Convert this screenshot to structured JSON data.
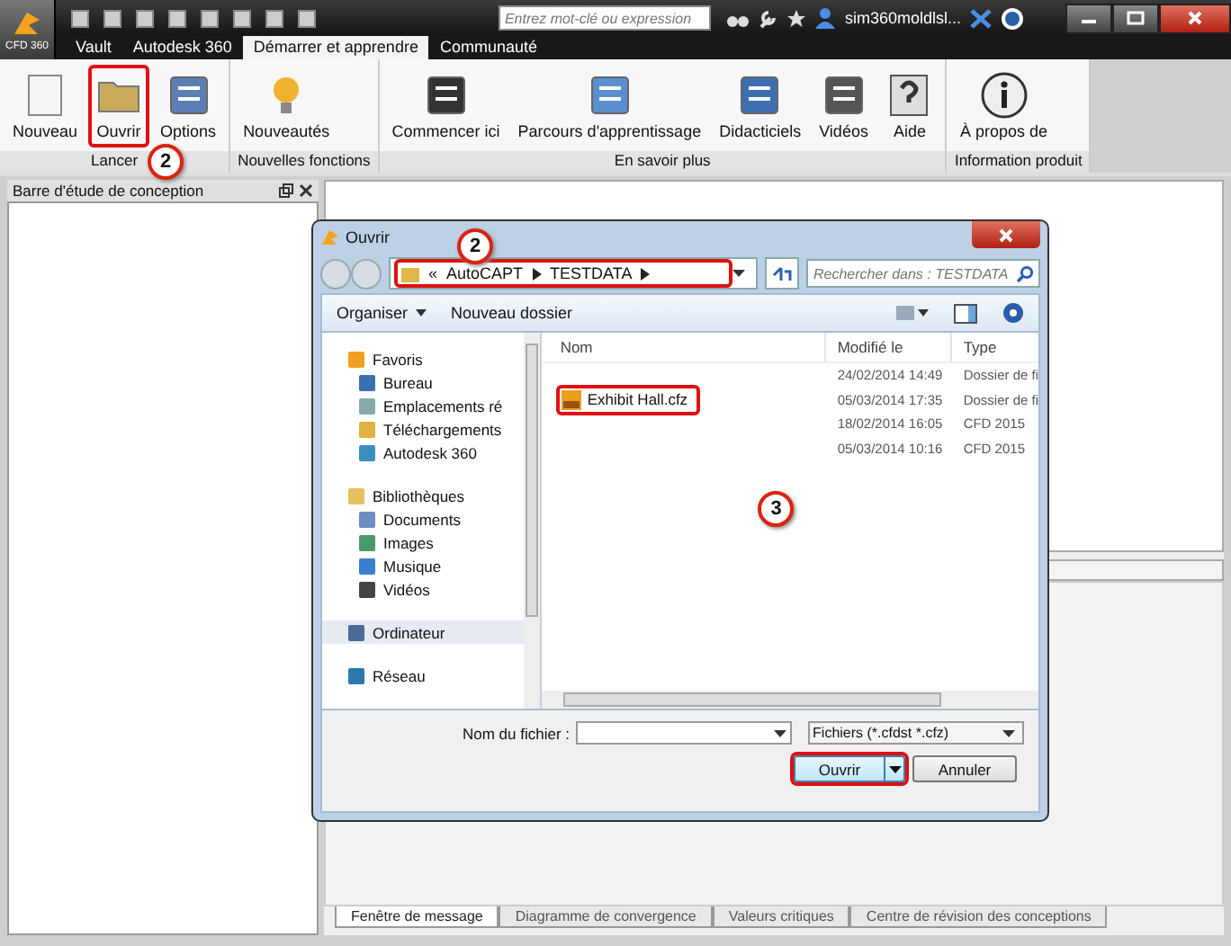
{
  "app": {
    "logo_label": "CFD 360",
    "search": {
      "placeholder": "Entrez mot-clé ou expression"
    },
    "user": "sim360moldlsl..."
  },
  "ribbon_tabs": [
    {
      "label": "Vault",
      "selected": false
    },
    {
      "label": "Autodesk 360",
      "selected": false
    },
    {
      "label": "Démarrer et apprendre",
      "selected": true
    },
    {
      "label": "Communauté",
      "selected": false
    }
  ],
  "ribbon_groups": [
    {
      "label": "Lancer",
      "buttons": [
        {
          "label": "Nouveau",
          "kind": "new",
          "highlighted": false
        },
        {
          "label": "Ouvrir",
          "kind": "open",
          "highlighted": true,
          "callout": "2"
        },
        {
          "label": "Options",
          "kind": "options",
          "highlighted": false
        }
      ]
    },
    {
      "label": "Nouvelles fonctions",
      "buttons": [
        {
          "label": "Nouveautés",
          "kind": "bulb",
          "highlighted": false
        }
      ]
    },
    {
      "label": "En savoir plus",
      "buttons": [
        {
          "label": "Commencer ici",
          "kind": "start",
          "highlighted": false
        },
        {
          "label": "Parcours d'apprentissage",
          "kind": "path",
          "highlighted": false
        },
        {
          "label": "Didacticiels",
          "kind": "tutorial",
          "highlighted": false
        },
        {
          "label": "Vidéos",
          "kind": "video",
          "highlighted": false
        },
        {
          "label": "Aide",
          "kind": "help",
          "highlighted": false
        }
      ]
    },
    {
      "label": "Information produit",
      "buttons": [
        {
          "label": "À propos de",
          "kind": "info",
          "highlighted": false
        }
      ]
    }
  ],
  "design_panel": {
    "title": "Barre d'étude de conception"
  },
  "bottom_tabs": [
    {
      "label": "Fenêtre de message",
      "selected": true
    },
    {
      "label": "Diagramme de convergence",
      "selected": false
    },
    {
      "label": "Valeurs critiques",
      "selected": false
    },
    {
      "label": "Centre de révision des conceptions",
      "selected": false
    }
  ],
  "dialog": {
    "title": "Ouvrir",
    "breadcrumb_overflow": "«",
    "breadcrumb": [
      "AutoCAPT",
      "TESTDATA"
    ],
    "breadcrumb_highlighted": true,
    "breadcrumb_callout": "2",
    "search": {
      "placeholder": "Rechercher dans : TESTDATA"
    },
    "toolbar": [
      "Organiser",
      "Nouveau dossier"
    ],
    "nav": [
      {
        "label": "Favoris",
        "kind": "star",
        "selected": false,
        "children": [
          {
            "label": "Bureau",
            "kind": "desktop",
            "selected": false
          },
          {
            "label": "Emplacements ré",
            "kind": "places",
            "selected": false
          },
          {
            "label": "Téléchargements",
            "kind": "download",
            "selected": false
          },
          {
            "label": "Autodesk 360",
            "kind": "cloud",
            "selected": false
          }
        ]
      },
      {
        "label": "Bibliothèques",
        "kind": "library",
        "selected": false,
        "children": [
          {
            "label": "Documents",
            "kind": "document",
            "selected": false
          },
          {
            "label": "Images",
            "kind": "image",
            "selected": false
          },
          {
            "label": "Musique",
            "kind": "music",
            "selected": false
          },
          {
            "label": "Vidéos",
            "kind": "film",
            "selected": false
          }
        ]
      },
      {
        "label": "Ordinateur",
        "kind": "computer",
        "selected": true
      },
      {
        "label": "Réseau",
        "kind": "network",
        "selected": false
      }
    ],
    "columns": [
      "Nom",
      "Modifié le",
      "Type"
    ],
    "rows": [
      {
        "modified": "24/02/2014 14:49",
        "type": "Dossier de fi",
        "highlighted": false
      },
      {
        "name": "Exhibit Hall.cfz",
        "modified": "05/03/2014 17:35",
        "type": "Dossier de fi",
        "highlighted": true
      },
      {
        "modified": "18/02/2014 16:05",
        "type": "CFD 2015",
        "highlighted": false
      },
      {
        "modified": "05/03/2014 10:16",
        "type": "CFD 2015",
        "highlighted": false
      }
    ],
    "list_callout": "3",
    "filename_label": "Nom du fichier :",
    "filter": "Fichiers (*.cfdst *.cfz)",
    "buttons": [
      {
        "label": "Ouvrir",
        "kind": "split",
        "highlighted": true
      },
      {
        "label": "Annuler",
        "kind": "plain",
        "highlighted": false
      }
    ]
  }
}
